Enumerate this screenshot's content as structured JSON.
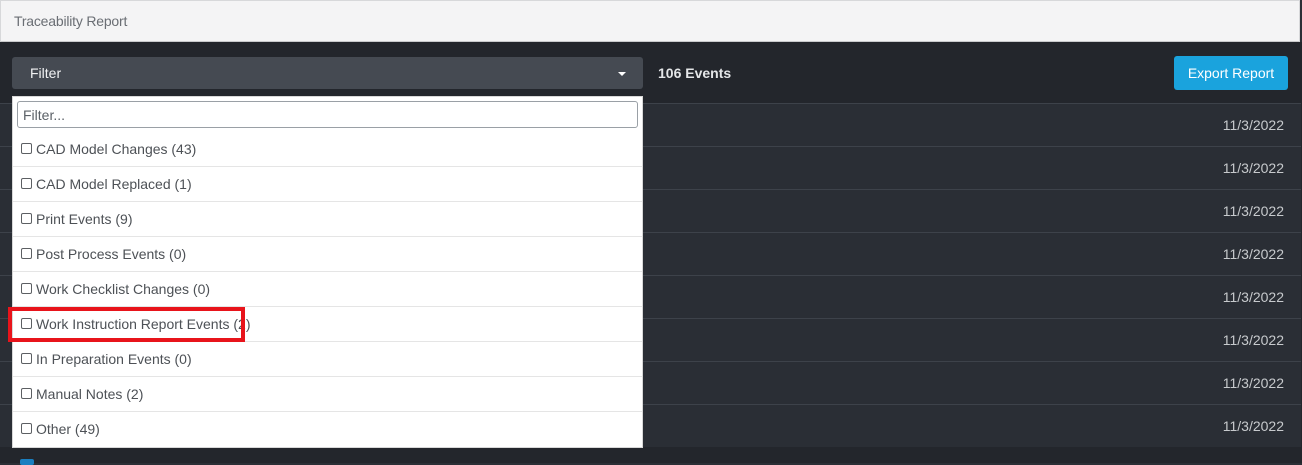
{
  "window": {
    "title": "Traceability Report"
  },
  "toolbar": {
    "filter_label": "Filter",
    "event_count": "106 Events",
    "export_label": "Export Report"
  },
  "dropdown": {
    "search_placeholder": "Filter...",
    "options": [
      {
        "label": "CAD Model Changes (43)",
        "checked": false
      },
      {
        "label": "CAD Model Replaced (1)",
        "checked": false
      },
      {
        "label": "Print Events (9)",
        "checked": false
      },
      {
        "label": "Post Process Events (0)",
        "checked": false
      },
      {
        "label": "Work Checklist Changes (0)",
        "checked": false
      },
      {
        "label": "Work Instruction Report Events (2)",
        "checked": false
      },
      {
        "label": "In Preparation Events (0)",
        "checked": false
      },
      {
        "label": "Manual Notes (2)",
        "checked": false
      },
      {
        "label": "Other (49)",
        "checked": false
      }
    ]
  },
  "events": {
    "rows": [
      {
        "date": "11/3/2022"
      },
      {
        "date": "11/3/2022"
      },
      {
        "date": "11/3/2022"
      },
      {
        "date": "11/3/2022"
      },
      {
        "date": "11/3/2022"
      },
      {
        "date": "11/3/2022"
      },
      {
        "date": "11/3/2022"
      },
      {
        "date": "11/3/2022"
      }
    ]
  },
  "colors": {
    "accent": "#1aa3dd",
    "highlight": "#e8141b",
    "background": "#23262c"
  }
}
